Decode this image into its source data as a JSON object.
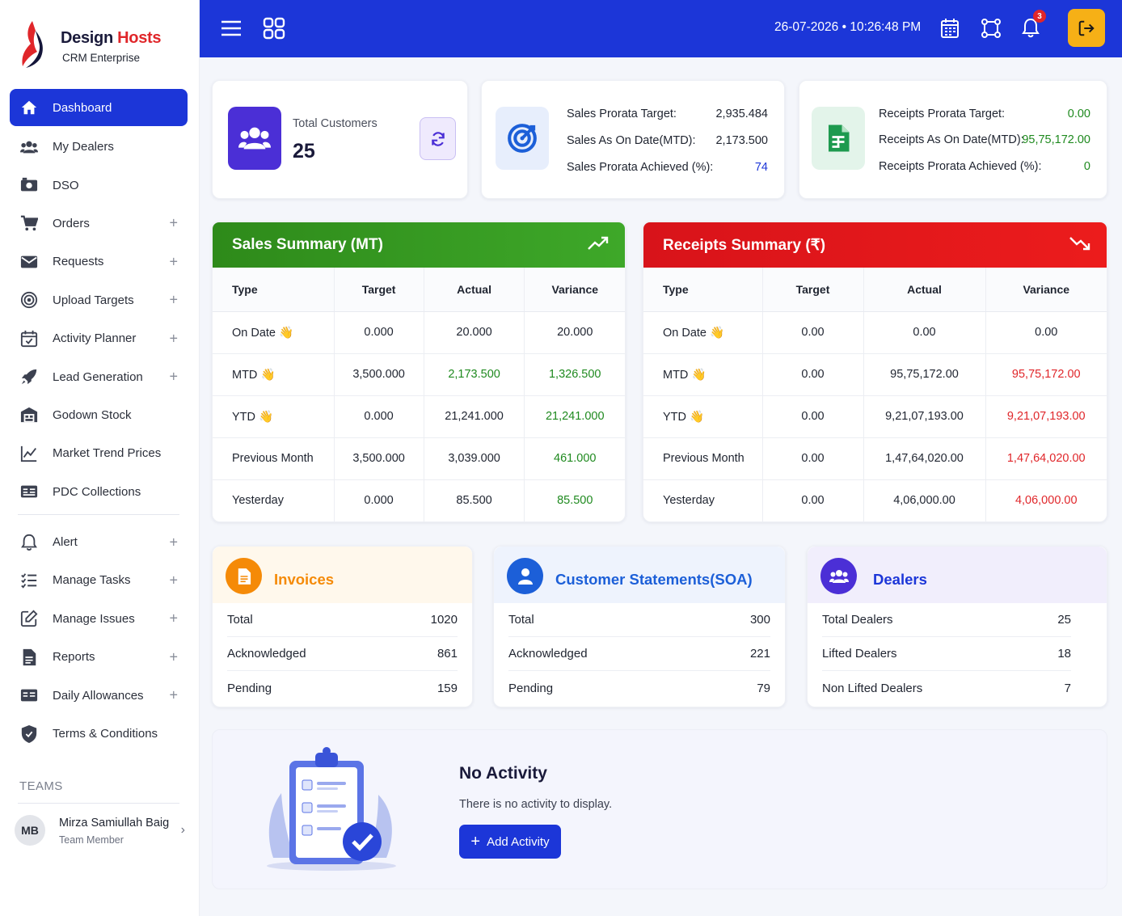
{
  "brand": {
    "name_part1": "Design",
    "name_part2": "Hosts",
    "subtitle": "CRM Enterprise"
  },
  "topbar": {
    "datetime": "26-07-2026 • 10:26:48 PM",
    "notification_count": "3"
  },
  "sidebar": {
    "items": [
      {
        "label": "Dashboard",
        "icon": "home-icon"
      },
      {
        "label": "My Dealers",
        "icon": "users-icon"
      },
      {
        "label": "DSO",
        "icon": "money-icon"
      },
      {
        "label": "Orders",
        "icon": "cart-icon",
        "expand": "+"
      },
      {
        "label": "Requests",
        "icon": "envelope-icon",
        "expand": "+"
      },
      {
        "label": "Upload Targets",
        "icon": "target-icon",
        "expand": "+"
      },
      {
        "label": "Activity Planner",
        "icon": "calendar-icon",
        "expand": "+"
      },
      {
        "label": "Lead Generation",
        "icon": "rocket-icon",
        "expand": "+"
      },
      {
        "label": "Godown Stock",
        "icon": "warehouse-icon"
      },
      {
        "label": "Market Trend Prices",
        "icon": "chart-line-icon"
      },
      {
        "label": "PDC Collections",
        "icon": "receipt-icon"
      },
      {
        "label": "Alert",
        "icon": "bell-icon",
        "expand": "+"
      },
      {
        "label": "Manage Tasks",
        "icon": "tasks-icon",
        "expand": "+"
      },
      {
        "label": "Manage Issues",
        "icon": "edit-icon",
        "expand": "+"
      },
      {
        "label": "Reports",
        "icon": "file-icon",
        "expand": "+"
      },
      {
        "label": "Daily Allowances",
        "icon": "wallet-icon",
        "expand": "+"
      },
      {
        "label": "Terms & Conditions",
        "icon": "shield-icon"
      }
    ],
    "teams_label": "TEAMS",
    "member": {
      "initials": "MB",
      "name": "Mirza Samiullah Baig",
      "role": "Team Member"
    }
  },
  "customers": {
    "label": "Total Customers",
    "value": "25"
  },
  "sales_prorata": {
    "rows": [
      {
        "label": "Sales Prorata Target:",
        "value": "2,935.484"
      },
      {
        "label": "Sales As On Date(MTD):",
        "value": "2,173.500"
      },
      {
        "label": "Sales Prorata Achieved (%):",
        "value": "74"
      }
    ]
  },
  "receipts_prorata": {
    "rows": [
      {
        "label": "Receipts Prorata Target:",
        "value": "0.00"
      },
      {
        "label": "Receipts As On Date(MTD):",
        "value": "95,75,172.00"
      },
      {
        "label": "Receipts Prorata Achieved (%):",
        "value": "0"
      }
    ]
  },
  "sales_summary": {
    "title": "Sales Summary (MT)",
    "headers": [
      "Type",
      "Target",
      "Actual",
      "Variance"
    ],
    "rows": [
      {
        "type": "On Date",
        "hand": "👋",
        "target": "0.000",
        "actual": "20.000",
        "variance": "20.000"
      },
      {
        "type": "MTD",
        "hand": "👋",
        "target": "3,500.000",
        "actual": "2,173.500",
        "variance": "1,326.500"
      },
      {
        "type": "YTD",
        "hand": "👋",
        "target": "0.000",
        "actual": "21,241.000",
        "variance": "21,241.000"
      },
      {
        "type": "Previous Month",
        "hand": "",
        "target": "3,500.000",
        "actual": "3,039.000",
        "variance": "461.000"
      },
      {
        "type": "Yesterday",
        "hand": "",
        "target": "0.000",
        "actual": "85.500",
        "variance": "85.500"
      }
    ]
  },
  "receipts_summary": {
    "title": "Receipts Summary (₹)",
    "headers": [
      "Type",
      "Target",
      "Actual",
      "Variance"
    ],
    "rows": [
      {
        "type": "On Date",
        "hand": "👋",
        "target": "0.00",
        "actual": "0.00",
        "variance": "0.00"
      },
      {
        "type": "MTD",
        "hand": "👋",
        "target": "0.00",
        "actual": "95,75,172.00",
        "variance": "95,75,172.00"
      },
      {
        "type": "YTD",
        "hand": "👋",
        "target": "0.00",
        "actual": "9,21,07,193.00",
        "variance": "9,21,07,193.00"
      },
      {
        "type": "Previous Month",
        "hand": "",
        "target": "0.00",
        "actual": "1,47,64,020.00",
        "variance": "1,47,64,020.00"
      },
      {
        "type": "Yesterday",
        "hand": "",
        "target": "0.00",
        "actual": "4,06,000.00",
        "variance": "4,06,000.00"
      }
    ]
  },
  "invoices": {
    "title": "Invoices",
    "rows": [
      {
        "label": "Total",
        "value": "1020"
      },
      {
        "label": "Acknowledged",
        "value": "861"
      },
      {
        "label": "Pending",
        "value": "159"
      }
    ]
  },
  "statements": {
    "title": "Customer Statements(SOA)",
    "rows": [
      {
        "label": "Total",
        "value": "300"
      },
      {
        "label": "Acknowledged",
        "value": "221"
      },
      {
        "label": "Pending",
        "value": "79"
      }
    ]
  },
  "dealers": {
    "title": "Dealers",
    "rows": [
      {
        "label": "Total Dealers",
        "value": "25"
      },
      {
        "label": "Lifted Dealers",
        "value": "18"
      },
      {
        "label": "Non Lifted Dealers",
        "value": "7"
      }
    ]
  },
  "activity": {
    "title": "No Activity",
    "text": "There is no activity to display.",
    "button": "Add Activity"
  },
  "colors": {
    "primary": "#1c36d8",
    "green_header": "#2f8f1f",
    "red_header": "#e0141a",
    "logout": "#f6b016",
    "orange": "#f58a07",
    "purple": "#4b2fd6"
  }
}
